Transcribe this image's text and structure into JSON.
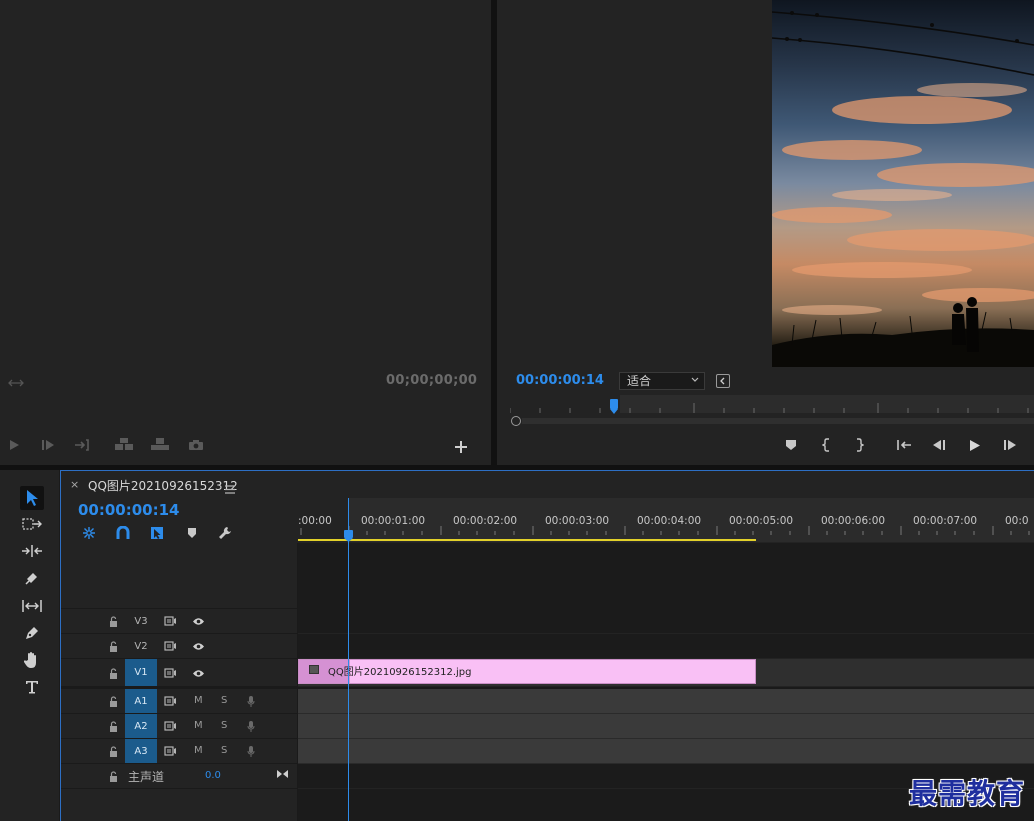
{
  "source_monitor": {
    "timecode": "00;00;00;00",
    "controls": [
      "play-icon",
      "step-forward-icon",
      "go-to-out-icon",
      "insert-icon",
      "overwrite-icon",
      "camera-icon",
      "add-icon"
    ]
  },
  "program_monitor": {
    "timecode": "00:00:00:14",
    "zoom_select": "适合",
    "controls": [
      "marker-icon",
      "mark-in-icon",
      "mark-out-icon",
      "go-to-in-icon",
      "step-back-icon",
      "play-icon",
      "step-forward-icon"
    ]
  },
  "timeline": {
    "sequence_name": "QQ图片20210926152312",
    "timecode": "00:00:00:14",
    "ruler": [
      ":00:00",
      "00:00:01:00",
      "00:00:02:00",
      "00:00:03:00",
      "00:00:04:00",
      "00:00:05:00",
      "00:00:06:00",
      "00:00:07:00",
      "00:0"
    ],
    "tracks": {
      "video": [
        {
          "name": "V3",
          "targeted": false
        },
        {
          "name": "V2",
          "targeted": false
        },
        {
          "name": "V1",
          "targeted": true
        }
      ],
      "audio": [
        {
          "name": "A1",
          "m": "M",
          "s": "S"
        },
        {
          "name": "A2",
          "m": "M",
          "s": "S"
        },
        {
          "name": "A3",
          "m": "M",
          "s": "S"
        }
      ],
      "master": {
        "name": "主声道",
        "value": "0.0"
      }
    },
    "clip": {
      "name": "QQ图片20210926152312.jpg"
    }
  },
  "watermark": "最需教育",
  "colors": {
    "accent": "#2d8ceb",
    "clip": "#f9c0f5",
    "target": "#1b5b8c"
  }
}
